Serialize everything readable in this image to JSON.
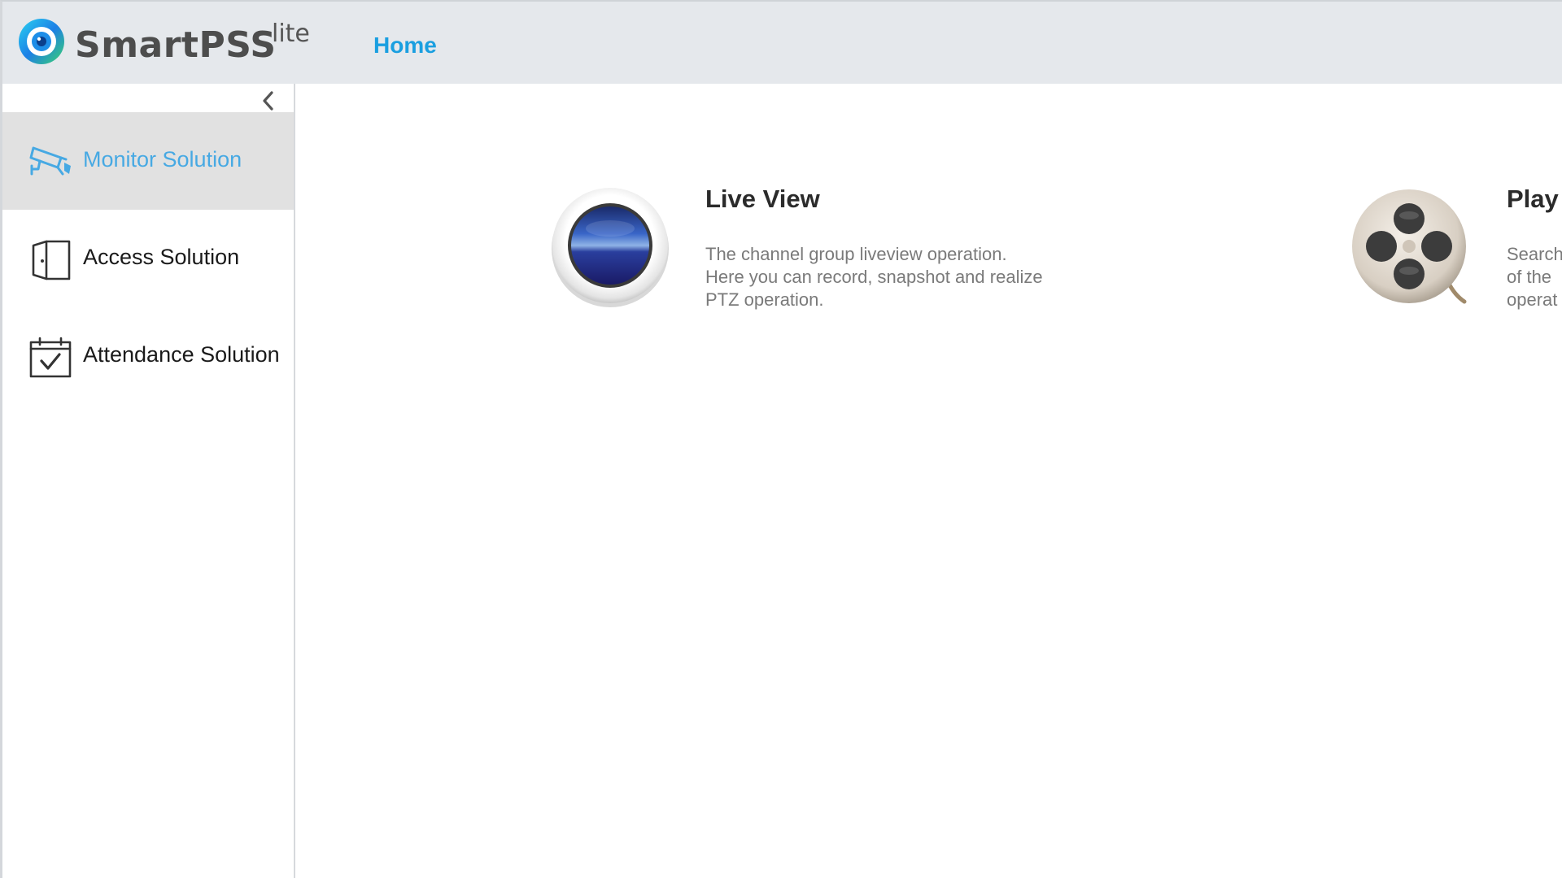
{
  "header": {
    "brand": "SmartPSS",
    "brand_suffix": "lite",
    "tabs": [
      {
        "label": "Home",
        "active": true
      }
    ]
  },
  "sidebar": {
    "collapse_icon": "chevron-left-icon",
    "items": [
      {
        "label": "Monitor Solution",
        "icon": "surveillance-camera-icon",
        "active": true
      },
      {
        "label": "Access Solution",
        "icon": "door-icon",
        "active": false
      },
      {
        "label": "Attendance Solution",
        "icon": "calendar-check-icon",
        "active": false
      }
    ]
  },
  "main": {
    "modules": [
      {
        "title": "Live View",
        "icon": "live-view-lens-icon",
        "description": "The channel group liveview operation. Here you can record, snapshot and realize PTZ operation."
      },
      {
        "title": "Play",
        "icon": "film-reel-icon",
        "description": "Search of the operat"
      }
    ]
  },
  "colors": {
    "accent": "#1a9fe0",
    "active_label": "#47a9e3",
    "header_bg": "#e5e8ec",
    "active_item_bg": "#e1e1e1"
  }
}
